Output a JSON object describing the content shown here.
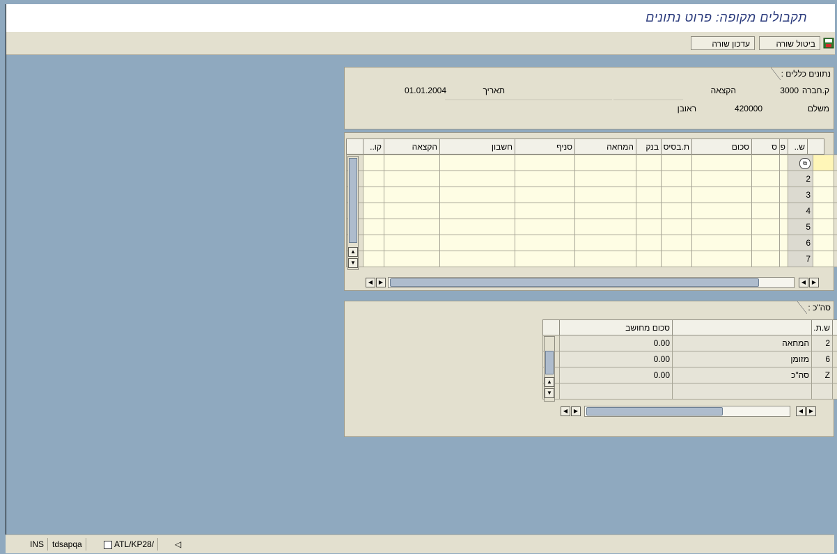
{
  "window": {
    "title": "תקבולים מקופה: פרוט נתונים"
  },
  "toolbar": {
    "cancel_row": "ביטול שורה",
    "update_row": "עדכון שורה"
  },
  "general": {
    "heading": "נתונים כללים :",
    "company_label": "ק.חברה",
    "company_value": "3000",
    "allocation_label": "הקצאה",
    "payer_label": "משלם",
    "payer_value": "420000",
    "payer_name": "ראובן",
    "date_label": "תאריך",
    "date_value": "01.01.2004"
  },
  "items": {
    "columns": [
      "ש..",
      "פריט",
      "ס",
      "סכום",
      "ת.בסיס",
      "המחאה",
      "בנק",
      "סניף",
      "חשבון",
      "הקצאה",
      "קו.."
    ],
    "rows": [
      "",
      "2",
      "3",
      "4",
      "5",
      "6",
      "7"
    ]
  },
  "totals": {
    "heading": "סה\"כ :",
    "columns": [
      "ש.ת.",
      "",
      "סכום מחושב"
    ],
    "rows": [
      {
        "code": "2",
        "name": "המחאה",
        "amount": "0.00"
      },
      {
        "code": "6",
        "name": "מזומן",
        "amount": "0.00"
      },
      {
        "code": "Z",
        "name": "סה\"כ",
        "amount": "0.00"
      },
      {
        "code": "",
        "name": "",
        "amount": ""
      }
    ]
  },
  "status": {
    "mode": "INS",
    "server": "tdsapqa",
    "session": "ATL/KP28/"
  }
}
